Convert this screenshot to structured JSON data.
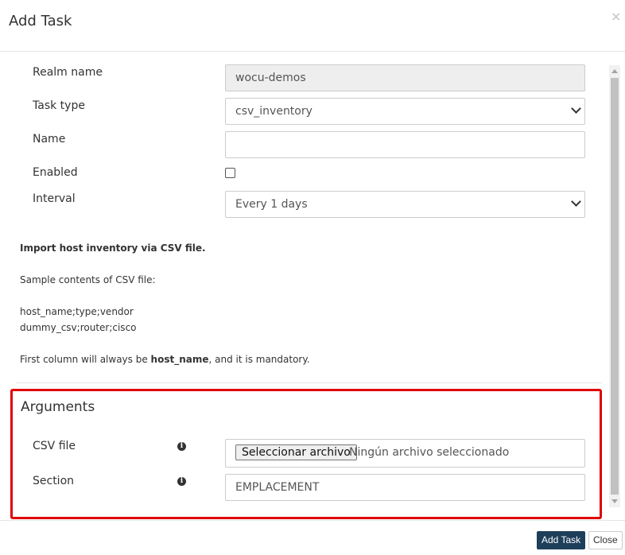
{
  "dialog": {
    "title": "Add Task",
    "close_glyph": "×"
  },
  "form": {
    "realm_label": "Realm name",
    "realm_value": "wocu-demos",
    "task_type_label": "Task type",
    "task_type_value": "csv_inventory",
    "name_label": "Name",
    "name_value": "",
    "enabled_label": "Enabled",
    "enabled_checked": false,
    "interval_label": "Interval",
    "interval_value": "Every 1 days"
  },
  "description": {
    "heading": "Import host inventory via CSV file.",
    "sample_intro": "Sample contents of CSV file:",
    "sample_line1": "host_name;type;vendor",
    "sample_line2": "dummy_csv;router;cisco",
    "note_prefix": "First column will always be ",
    "note_bold": "host_name",
    "note_suffix": ", and it is mandatory."
  },
  "arguments": {
    "title": "Arguments",
    "csv_label": "CSV file",
    "csv_button": "Seleccionar archivo",
    "csv_none": "Ningún archivo seleccionado",
    "section_label": "Section",
    "section_value": "EMPLACEMENT",
    "info_icon": "info-circle"
  },
  "footer": {
    "add_task_label": "Add Task",
    "close_label": "Close"
  },
  "colors": {
    "primary": "#1e3f5a",
    "highlight": "#e00000"
  }
}
